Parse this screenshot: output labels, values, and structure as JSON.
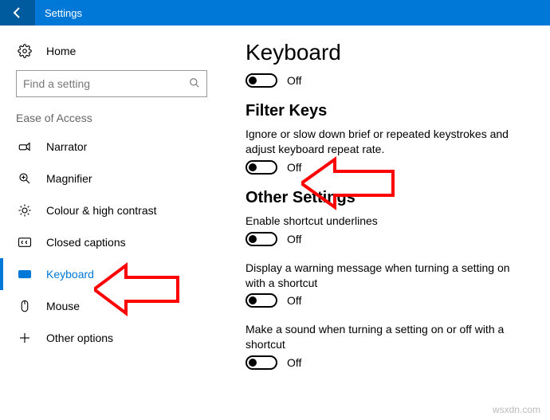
{
  "titlebar": {
    "title": "Settings"
  },
  "sidebar": {
    "home": "Home",
    "search_placeholder": "Find a setting",
    "section": "Ease of Access",
    "items": [
      {
        "label": "Narrator"
      },
      {
        "label": "Magnifier"
      },
      {
        "label": "Colour & high contrast"
      },
      {
        "label": "Closed captions"
      },
      {
        "label": "Keyboard"
      },
      {
        "label": "Mouse"
      },
      {
        "label": "Other options"
      }
    ]
  },
  "content": {
    "page_title": "Keyboard",
    "top_toggle": "Off",
    "filter_keys": {
      "heading": "Filter Keys",
      "desc": "Ignore or slow down brief or repeated keystrokes and adjust keyboard repeat rate.",
      "toggle": "Off"
    },
    "other": {
      "heading": "Other Settings",
      "items": [
        {
          "desc": "Enable shortcut underlines",
          "toggle": "Off"
        },
        {
          "desc": "Display a warning message when turning a setting on with a shortcut",
          "toggle": "Off"
        },
        {
          "desc": "Make a sound when turning a setting on or off with a shortcut",
          "toggle": "Off"
        }
      ]
    }
  },
  "watermark": "wsxdn.com"
}
